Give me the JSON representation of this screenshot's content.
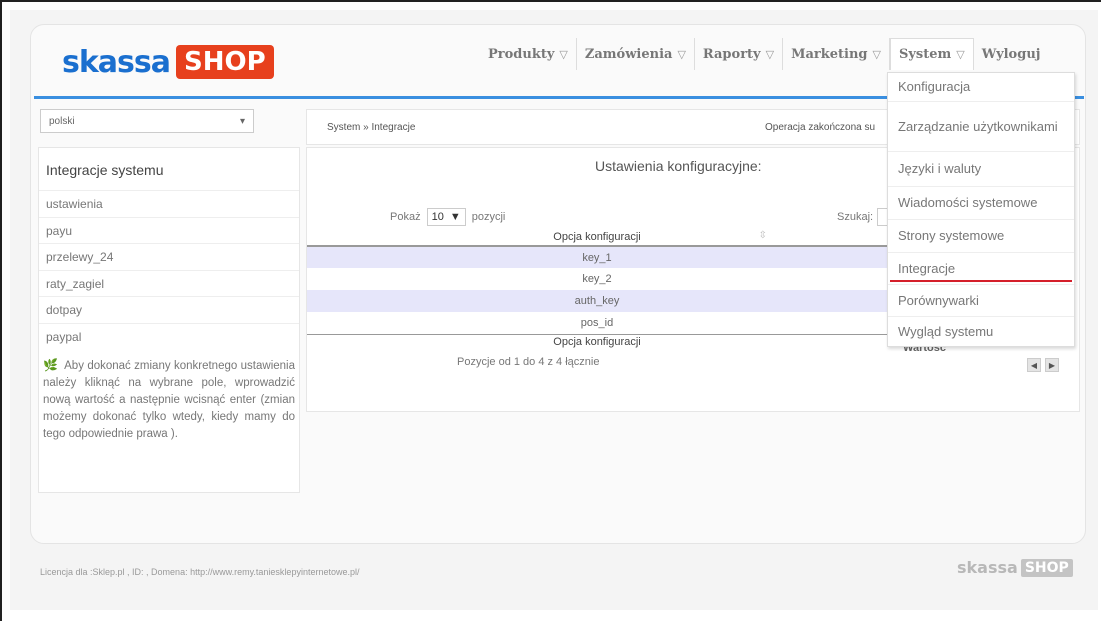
{
  "logo": {
    "word": "skassa",
    "shop": "SHOP"
  },
  "nav": [
    {
      "label": "Produkty",
      "caret": "▽"
    },
    {
      "label": "Zamówienia",
      "caret": "▽"
    },
    {
      "label": "Raporty",
      "caret": "▽"
    },
    {
      "label": "Marketing",
      "caret": "▽"
    },
    {
      "label": "System",
      "caret": "▽"
    },
    {
      "label": "Wyloguj",
      "caret": ""
    }
  ],
  "language": {
    "value": "polski",
    "arrow": "▾"
  },
  "sidebar": {
    "title": "Integracje systemu",
    "items": [
      "ustawienia",
      "payu",
      "przelewy_24",
      "raty_zagiel",
      "dotpay",
      "paypal"
    ],
    "note_icon": "🌿",
    "note": "Aby dokonać zmiany konkretnego ustawienia należy kliknąć na wybrane pole, wprowadzić nową wartość a następnie wcisnąć enter (zmian możemy dokonać tylko wtedy, kiedy mamy do tego odpowiednie prawa )."
  },
  "breadcrumb": "System » Integracje",
  "status": "Operacja zakończona su",
  "main": {
    "title": "Ustawienia konfiguracyjne:",
    "show_label": "Pokaż",
    "show_value": "10",
    "show_arrow": "▼",
    "show_suffix": "pozycji",
    "search_label": "Szukaj:",
    "column": "Opcja konfiguracji",
    "sort_icon": "⇳",
    "rows": [
      "key_1",
      "key_2",
      "auth_key",
      "pos_id"
    ],
    "footer_column": "Opcja konfiguracji",
    "info": "Pozycje od 1 do 4 z 4 łącznie",
    "partial_value": "Wartość",
    "prev": "◀",
    "next": "▶"
  },
  "system_menu": [
    "Konfiguracja",
    "Zarządzanie użytkownikami",
    "Języki i waluty",
    "Wiadomości systemowe",
    "Strony systemowe",
    "Integracje",
    "Porównywarki",
    "Wygląd systemu"
  ],
  "footer": "Licencja dla :Sklep.pl , ID: , Domena: http://www.remy.taniesklepyinternetowe.pl/",
  "colors": {
    "accent": "#3a8fe0",
    "brand": "#e7401d",
    "active_underline": "#d51f2b",
    "row_highlight": "#e6e6fa"
  }
}
